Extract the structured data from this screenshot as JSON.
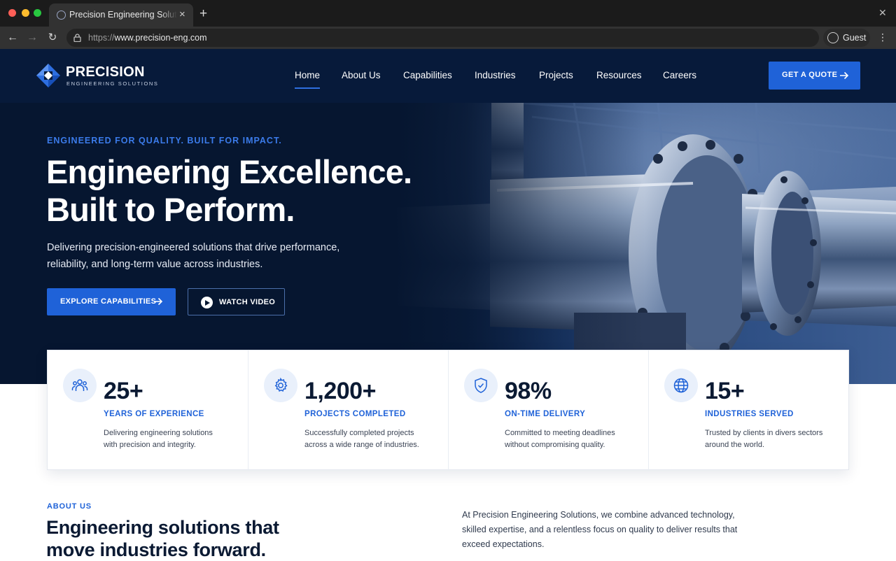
{
  "browser": {
    "tab_title": "Precision Engineering Solutions",
    "url_scheme": "https://",
    "url_host": "www.precision-eng.com",
    "profile_label": "Guest"
  },
  "header": {
    "logo_name": "PRECISION",
    "logo_tagline": "ENGINEERING SOLUTIONS",
    "nav": [
      {
        "label": "Home",
        "active": true
      },
      {
        "label": "About Us"
      },
      {
        "label": "Capabilities"
      },
      {
        "label": "Industries"
      },
      {
        "label": "Projects"
      },
      {
        "label": "Resources"
      },
      {
        "label": "Careers"
      }
    ],
    "cta_label": "GET A QUOTE"
  },
  "hero": {
    "eyebrow": "ENGINEERED FOR QUALITY. BUILT FOR IMPACT.",
    "title_line1": "Engineering Excellence.",
    "title_line2": "Built to Perform.",
    "subtitle": "Delivering precision-engineered solutions that drive performance, reliability, and long-term value across industries.",
    "primary_cta": "EXPLORE CAPABILITIES",
    "secondary_cta": "WATCH VIDEO"
  },
  "stats": [
    {
      "icon": "team-icon",
      "value": "25+",
      "label": "YEARS OF EXPERIENCE",
      "desc": "Delivering engineering solutions with precision and integrity."
    },
    {
      "icon": "gear-icon",
      "value": "1,200+",
      "label": "PROJECTS COMPLETED",
      "desc": "Successfully completed projects across a wide range of industries."
    },
    {
      "icon": "shield-check-icon",
      "value": "98%",
      "label": "ON-TIME DELIVERY",
      "desc": "Committed to meeting deadlines without compromising quality."
    },
    {
      "icon": "globe-icon",
      "value": "15+",
      "label": "INDUSTRIES SERVED",
      "desc": "Trusted by clients in divers sectors around the world."
    }
  ],
  "about": {
    "eyebrow": "ABOUT US",
    "title_line1": "Engineering solutions that",
    "title_line2": "move industries forward.",
    "body": "At Precision Engineering Solutions, we combine advanced technology, skilled expertise, and a relentless focus on quality to deliver results that exceed expectations."
  },
  "colors": {
    "navy": "#071a3a",
    "accent_blue": "#1f62d8",
    "eyebrow_blue": "#3b7bea"
  }
}
